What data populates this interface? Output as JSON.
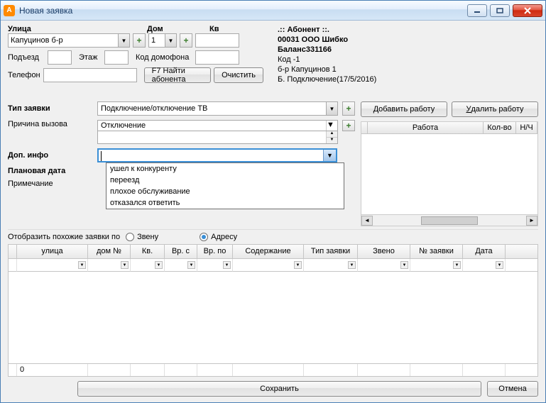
{
  "window": {
    "title": "Новая заявка"
  },
  "address": {
    "street_label": "Улица",
    "house_label": "Дом",
    "apt_label": "Кв",
    "street_value": "Капуцинов б-р",
    "house_value": "1",
    "apt_value": "",
    "entrance_label": "Подъезд",
    "entrance_value": "",
    "floor_label": "Этаж",
    "floor_value": "",
    "doorcode_label": "Код домофона",
    "doorcode_value": "",
    "phone_label": "Телефон",
    "phone_value": "",
    "find_subscriber_btn": "F7 Найти абонента",
    "clear_btn": "Очистить"
  },
  "subscriber": {
    "header": ".:: Абонент ::.",
    "line1": "00031 ООО Шибко",
    "line2": "Баланс331166",
    "line3": "Код -1",
    "line4": "б-р Капуцинов 1",
    "line5": "Б. Подключение(17/5/2016)"
  },
  "request": {
    "type_label": "Тип заявки",
    "type_value": "Подключение/отключение ТВ",
    "reason_label": "Причина вызова",
    "reason_value": "Отключение",
    "addinfo_label": "Доп. инфо",
    "addinfo_value": "",
    "addinfo_options": [
      "ушел к конкуренту",
      "переезд",
      "плохое обслуживание",
      "отказался ответить"
    ],
    "plandate_label": "Плановая дата",
    "note_label": "Примечание"
  },
  "work": {
    "add_btn_prefix": "Д",
    "add_btn_rest": "обавить работу",
    "del_btn_prefix": "У",
    "del_btn_rest": "далить работу",
    "col_work": "Работа",
    "col_qty": "Кол-во",
    "col_nh": "Н/Ч"
  },
  "filter": {
    "label": "Отобразить похожие заявки по",
    "by_link": "Звену",
    "by_address": "Адресу"
  },
  "lower_cols": {
    "street": "улица",
    "house": "дом №",
    "apt": "Кв.",
    "from": "Вр. с",
    "to": "Вр. по",
    "content": "Содержание",
    "type": "Тип заявки",
    "link": "Звено",
    "num": "№ заявки",
    "date": "Дата"
  },
  "lower_total": "0",
  "footer": {
    "save": "Сохранить",
    "cancel": "Отмена"
  }
}
